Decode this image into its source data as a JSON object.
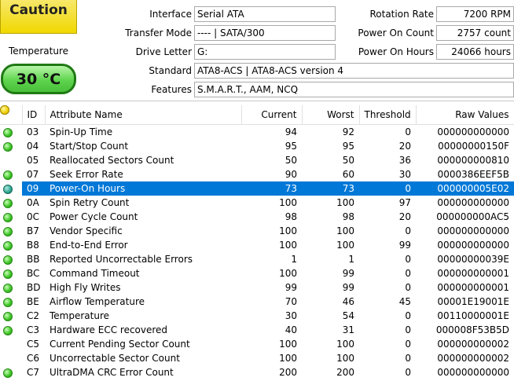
{
  "health": {
    "status": "Caution",
    "temperature_label": "Temperature",
    "temperature": "30 °C"
  },
  "info": {
    "left": [
      {
        "label": "Interface",
        "value": "Serial ATA"
      },
      {
        "label": "Transfer Mode",
        "value": "---- | SATA/300"
      },
      {
        "label": "Drive Letter",
        "value": "G:"
      }
    ],
    "standard": {
      "label": "Standard",
      "value": "ATA8-ACS | ATA8-ACS version 4"
    },
    "features": {
      "label": "Features",
      "value": "S.M.A.R.T., AAM, NCQ"
    },
    "right": [
      {
        "label": "Rotation Rate",
        "value": "7200 RPM"
      },
      {
        "label": "Power On Count",
        "value": "2757 count"
      },
      {
        "label": "Power On Hours",
        "value": "24066 hours"
      }
    ]
  },
  "table": {
    "headers": {
      "id": "ID",
      "name": "Attribute Name",
      "current": "Current",
      "worst": "Worst",
      "threshold": "Threshold",
      "raw": "Raw Values"
    },
    "rows": [
      {
        "status": "good",
        "id": "03",
        "name": "Spin-Up Time",
        "current": "94",
        "worst": "92",
        "threshold": "0",
        "raw": "000000000000"
      },
      {
        "status": "good",
        "id": "04",
        "name": "Start/Stop Count",
        "current": "95",
        "worst": "95",
        "threshold": "20",
        "raw": "00000000150F"
      },
      {
        "status": "caution",
        "id": "05",
        "name": "Reallocated Sectors Count",
        "current": "50",
        "worst": "50",
        "threshold": "36",
        "raw": "000000000810"
      },
      {
        "status": "good",
        "id": "07",
        "name": "Seek Error Rate",
        "current": "90",
        "worst": "60",
        "threshold": "30",
        "raw": "0000386EEF5B"
      },
      {
        "status": "selected",
        "id": "09",
        "name": "Power-On Hours",
        "current": "73",
        "worst": "73",
        "threshold": "0",
        "raw": "000000005E02"
      },
      {
        "status": "good",
        "id": "0A",
        "name": "Spin Retry Count",
        "current": "100",
        "worst": "100",
        "threshold": "97",
        "raw": "000000000000"
      },
      {
        "status": "good",
        "id": "0C",
        "name": "Power Cycle Count",
        "current": "98",
        "worst": "98",
        "threshold": "20",
        "raw": "000000000AC5"
      },
      {
        "status": "good",
        "id": "B7",
        "name": "Vendor Specific",
        "current": "100",
        "worst": "100",
        "threshold": "0",
        "raw": "000000000000"
      },
      {
        "status": "good",
        "id": "B8",
        "name": "End-to-End Error",
        "current": "100",
        "worst": "100",
        "threshold": "99",
        "raw": "000000000000"
      },
      {
        "status": "good",
        "id": "BB",
        "name": "Reported Uncorrectable Errors",
        "current": "1",
        "worst": "1",
        "threshold": "0",
        "raw": "00000000039E"
      },
      {
        "status": "good",
        "id": "BC",
        "name": "Command Timeout",
        "current": "100",
        "worst": "99",
        "threshold": "0",
        "raw": "000000000001"
      },
      {
        "status": "good",
        "id": "BD",
        "name": "High Fly Writes",
        "current": "99",
        "worst": "99",
        "threshold": "0",
        "raw": "000000000001"
      },
      {
        "status": "good",
        "id": "BE",
        "name": "Airflow Temperature",
        "current": "70",
        "worst": "46",
        "threshold": "45",
        "raw": "00001E19001E"
      },
      {
        "status": "good",
        "id": "C2",
        "name": "Temperature",
        "current": "30",
        "worst": "54",
        "threshold": "0",
        "raw": "00110000001E"
      },
      {
        "status": "good",
        "id": "C3",
        "name": "Hardware ECC recovered",
        "current": "40",
        "worst": "31",
        "threshold": "0",
        "raw": "000008F53B5D"
      },
      {
        "status": "caution",
        "id": "C5",
        "name": "Current Pending Sector Count",
        "current": "100",
        "worst": "100",
        "threshold": "0",
        "raw": "000000000002"
      },
      {
        "status": "caution",
        "id": "C6",
        "name": "Uncorrectable Sector Count",
        "current": "100",
        "worst": "100",
        "threshold": "0",
        "raw": "000000000002"
      },
      {
        "status": "good",
        "id": "C7",
        "name": "UltraDMA CRC Error Count",
        "current": "200",
        "worst": "200",
        "threshold": "0",
        "raw": "000000000000"
      }
    ]
  }
}
